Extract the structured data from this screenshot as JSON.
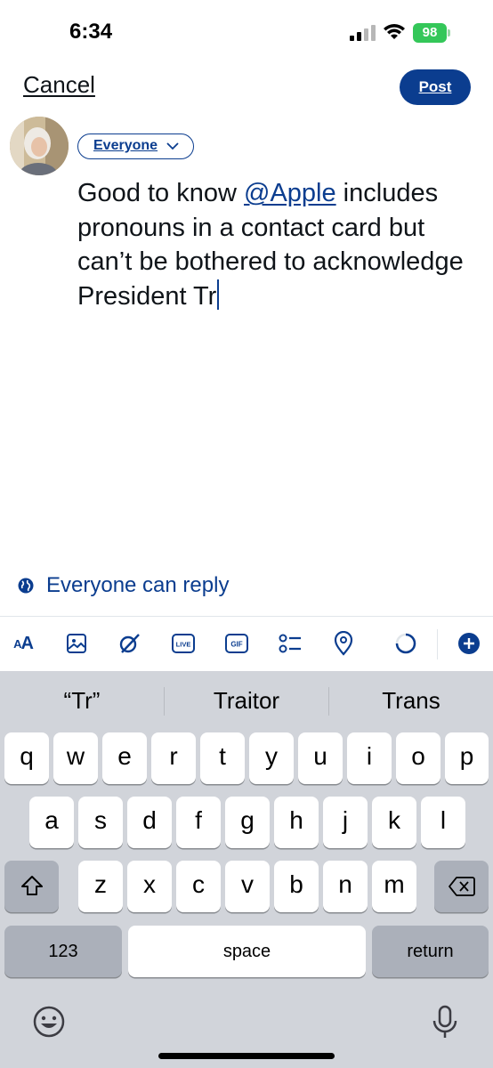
{
  "status_bar": {
    "time": "6:34",
    "battery": "98"
  },
  "header": {
    "cancel_label": "Cancel",
    "post_label": "Post"
  },
  "composer": {
    "audience_label": "Everyone",
    "text_before_mention": "Good to know ",
    "mention": "@Apple",
    "text_after_mention": " includes pronouns in a contact card but can’t be bothered to acknowledge President Tr",
    "reply_setting": "Everyone can reply"
  },
  "toolbar": {
    "text_format_label_big": "A",
    "text_format_label_small": "A",
    "live_label": "LIVE",
    "gif_label": "GIF",
    "icons": [
      "text-format-icon",
      "image-icon",
      "grok-icon",
      "live-icon",
      "gif-icon",
      "poll-icon",
      "location-icon",
      "character-count-icon",
      "add-post-icon"
    ]
  },
  "keyboard": {
    "suggestions": [
      "“Tr”",
      "Traitor",
      "Trans"
    ],
    "row1": [
      "q",
      "w",
      "e",
      "r",
      "t",
      "y",
      "u",
      "i",
      "o",
      "p"
    ],
    "row2": [
      "a",
      "s",
      "d",
      "f",
      "g",
      "h",
      "j",
      "k",
      "l"
    ],
    "row3": [
      "z",
      "x",
      "c",
      "v",
      "b",
      "n",
      "m"
    ],
    "numbers_label": "123",
    "space_label": "space",
    "return_label": "return"
  },
  "colors": {
    "accent": "#0b3d8f",
    "battery": "#34c759",
    "keyboard_bg": "#d1d4da",
    "function_key": "#abb0ba"
  }
}
